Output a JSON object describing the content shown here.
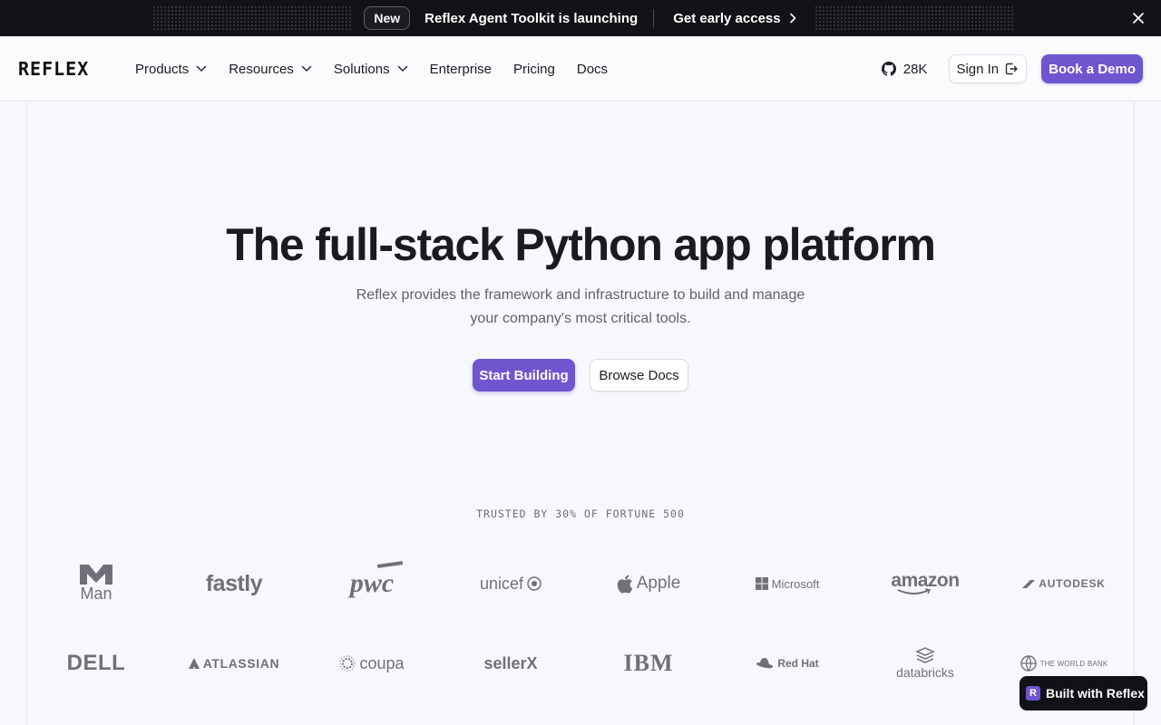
{
  "banner": {
    "new_label": "New",
    "message": "Reflex Agent Toolkit is launching",
    "cta_label": "Get early access"
  },
  "nav": {
    "logo": "REFLEX",
    "links": [
      "Products",
      "Resources",
      "Solutions",
      "Enterprise",
      "Pricing",
      "Docs"
    ],
    "github_stars": "28K",
    "signin_label": "Sign In",
    "demo_label": "Book a Demo"
  },
  "hero": {
    "title": "The full-stack Python app platform",
    "subtitle_line1": "Reflex provides the framework and infrastructure to build and manage",
    "subtitle_line2": "your company's most critical tools.",
    "primary_cta": "Start Building",
    "secondary_cta": "Browse Docs"
  },
  "trusted": {
    "label": "TRUSTED BY 30% OF FORTUNE 500",
    "row1": [
      "Man",
      "fastly",
      "pwc",
      "unicef",
      "Apple",
      "Microsoft",
      "amazon",
      "AUTODESK"
    ],
    "row2": [
      "DELL",
      "ATLASSIAN",
      "coupa",
      "sellerX",
      "IBM",
      "Red Hat",
      "databricks",
      "THE WORLD BANK"
    ]
  },
  "badge": {
    "label": "Built with Reflex",
    "icon_letter": "R"
  },
  "colors": {
    "accent": "#6e56cf",
    "banner_bg": "#121316",
    "page_bg": "#f7f8fb"
  }
}
